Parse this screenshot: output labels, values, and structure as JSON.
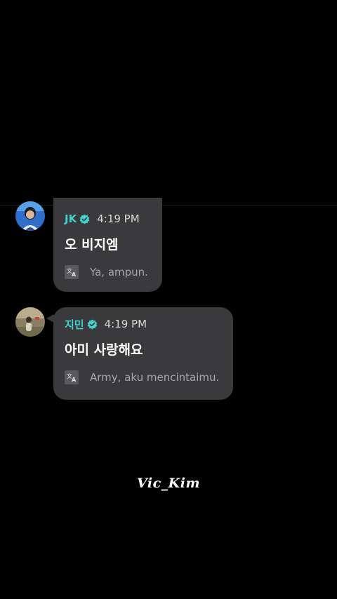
{
  "messages": [
    {
      "sender": "JK",
      "time": "4:19 PM",
      "text": "오 비지엠",
      "translation": "Ya, ampun.",
      "avatar": "jk-avatar",
      "verified": true
    },
    {
      "sender": "지민",
      "time": "4:19 PM",
      "text": "아미 사랑해요",
      "translation": "Army, aku mencintaimu.",
      "avatar": "jimin-avatar",
      "verified": true
    }
  ],
  "watermark": "Vic_Kim",
  "icons": {
    "verified": "verified-badge-icon",
    "translate": "translate-icon"
  },
  "colors": {
    "background": "#000000",
    "bubble": "#3a3a3c",
    "sender": "#41d1ce",
    "translation_text": "#a7a7ab"
  }
}
